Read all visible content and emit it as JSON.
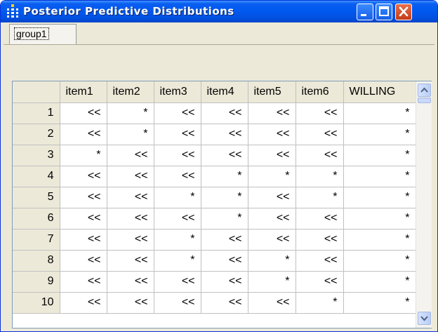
{
  "window": {
    "title": "Posterior Predictive Distributions"
  },
  "tabs": [
    {
      "label": "group1"
    }
  ],
  "grid": {
    "columns": [
      "item1",
      "item2",
      "item3",
      "item4",
      "item5",
      "item6",
      "WILLING"
    ],
    "rows": [
      {
        "id": "1",
        "cells": [
          "<<",
          "*",
          "<<",
          "<<",
          "<<",
          "<<",
          "*"
        ]
      },
      {
        "id": "2",
        "cells": [
          "<<",
          "*",
          "<<",
          "<<",
          "<<",
          "<<",
          "*"
        ]
      },
      {
        "id": "3",
        "cells": [
          "*",
          "<<",
          "<<",
          "<<",
          "<<",
          "<<",
          "*"
        ]
      },
      {
        "id": "4",
        "cells": [
          "<<",
          "<<",
          "<<",
          "*",
          "*",
          "*",
          "*"
        ]
      },
      {
        "id": "5",
        "cells": [
          "<<",
          "<<",
          "*",
          "*",
          "<<",
          "*",
          "*"
        ]
      },
      {
        "id": "6",
        "cells": [
          "<<",
          "<<",
          "<<",
          "*",
          "<<",
          "<<",
          "*"
        ]
      },
      {
        "id": "7",
        "cells": [
          "<<",
          "<<",
          "*",
          "<<",
          "<<",
          "<<",
          "*"
        ]
      },
      {
        "id": "8",
        "cells": [
          "<<",
          "<<",
          "*",
          "<<",
          "*",
          "<<",
          "*"
        ]
      },
      {
        "id": "9",
        "cells": [
          "<<",
          "<<",
          "<<",
          "<<",
          "*",
          "<<",
          "*"
        ]
      },
      {
        "id": "10",
        "cells": [
          "<<",
          "<<",
          "<<",
          "<<",
          "<<",
          "*",
          "*"
        ]
      }
    ]
  },
  "icons": {
    "app": "table-dots-icon",
    "minimize": "minimize-icon",
    "maximize": "maximize-icon",
    "close": "close-icon",
    "scroll_up": "chevron-up-icon",
    "scroll_down": "chevron-down-icon"
  },
  "colors": {
    "titlebar": "#0058ee",
    "close_button": "#c43b16",
    "window_face": "#ece9d8"
  }
}
